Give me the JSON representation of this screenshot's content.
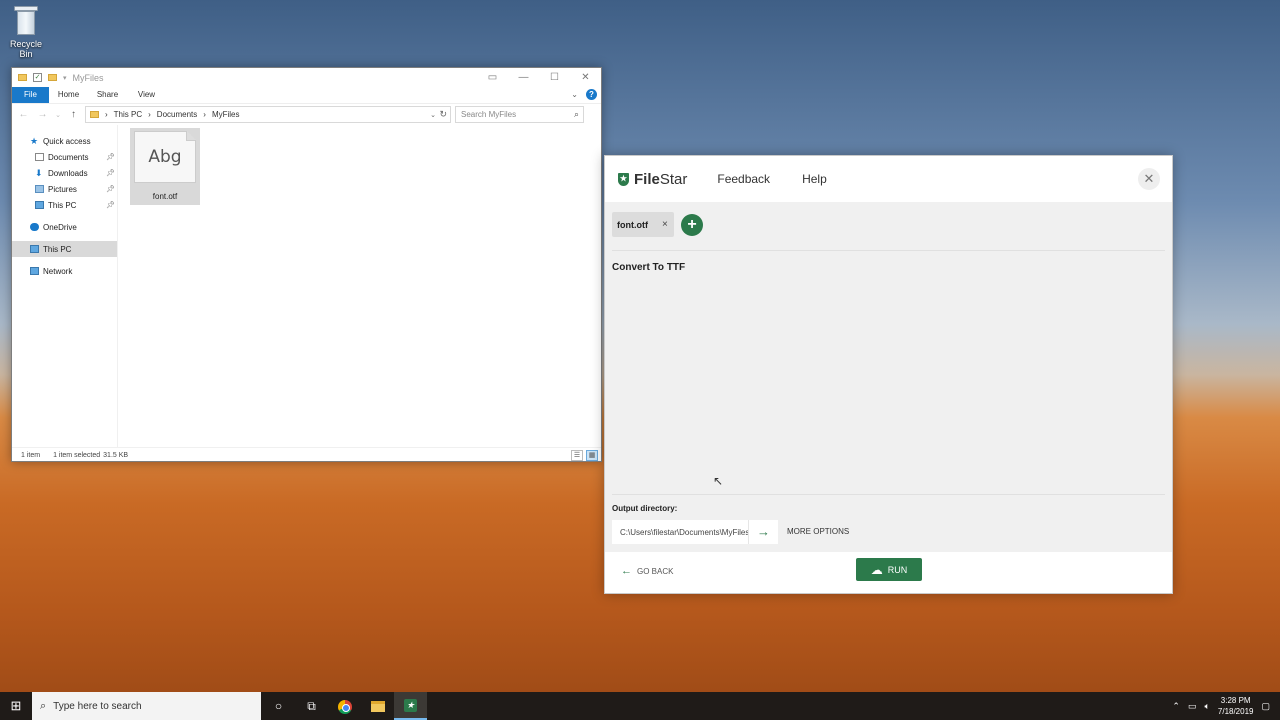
{
  "desktop": {
    "recycle_bin_label": "Recycle Bin"
  },
  "explorer": {
    "title": "MyFiles",
    "ribbon_tabs": [
      "File",
      "Home",
      "Share",
      "View"
    ],
    "path": [
      "This PC",
      "Documents",
      "MyFiles"
    ],
    "search_placeholder": "Search MyFiles",
    "nav": [
      {
        "label": "Quick access",
        "icon": "star-icon",
        "pinned": false,
        "indent": 0
      },
      {
        "label": "Documents",
        "icon": "documents-icon",
        "pinned": true,
        "indent": 1
      },
      {
        "label": "Downloads",
        "icon": "downloads-icon",
        "pinned": true,
        "indent": 1
      },
      {
        "label": "Pictures",
        "icon": "pictures-icon",
        "pinned": true,
        "indent": 1
      },
      {
        "label": "This PC",
        "icon": "computer-icon",
        "pinned": true,
        "indent": 1
      },
      {
        "label": "OneDrive",
        "icon": "cloud-icon",
        "pinned": false,
        "indent": 0
      },
      {
        "label": "This PC",
        "icon": "computer-icon",
        "pinned": false,
        "indent": 0
      },
      {
        "label": "Network",
        "icon": "network-icon",
        "pinned": false,
        "indent": 0
      }
    ],
    "file": {
      "name": "font.otf",
      "preview_text": "Abg"
    },
    "status": {
      "count": "1 item",
      "selected": "1 item selected",
      "size": "31.5 KB"
    }
  },
  "filestar": {
    "logo_file": "File",
    "logo_star": "Star",
    "nav": {
      "feedback": "Feedback",
      "help": "Help"
    },
    "chip_label": "font.otf",
    "chip_close": "×",
    "add_symbol": "+",
    "convert_title": "Convert To TTF",
    "output_label": "Output directory:",
    "output_path": "C:\\Users\\filestar\\Documents\\MyFiles",
    "more_options": "MORE OPTIONS",
    "go_back": "GO BACK",
    "run": "RUN",
    "accent_color": "#2c7a4b"
  },
  "taskbar": {
    "search_placeholder": "Type here to search",
    "time": "3:28 PM",
    "date": "7/18/2019"
  }
}
